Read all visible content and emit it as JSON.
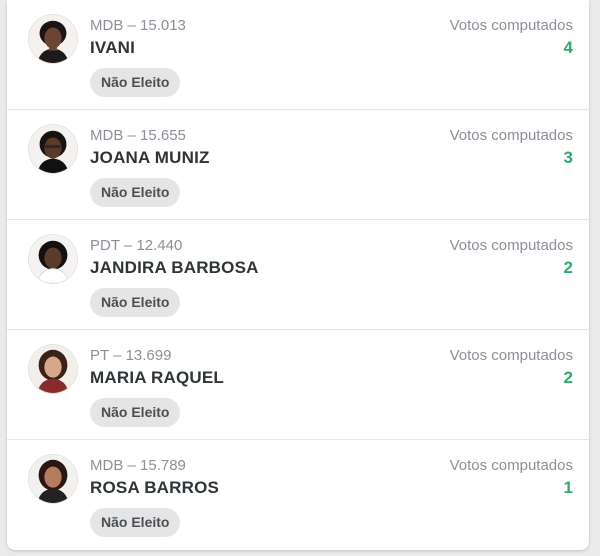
{
  "accent_color": "#2eab6d",
  "candidates": [
    {
      "party_number": "MDB – 15.013",
      "name": "IVANI",
      "status": "Não Eleito",
      "votes_label": "Votos computados",
      "votes": "4",
      "avatar_icon": "candidate-photo"
    },
    {
      "party_number": "MDB – 15.655",
      "name": "JOANA MUNIZ",
      "status": "Não Eleito",
      "votes_label": "Votos computados",
      "votes": "3",
      "avatar_icon": "candidate-photo"
    },
    {
      "party_number": "PDT – 12.440",
      "name": "JANDIRA BARBOSA",
      "status": "Não Eleito",
      "votes_label": "Votos computados",
      "votes": "2",
      "avatar_icon": "candidate-photo"
    },
    {
      "party_number": "PT – 13.699",
      "name": "MARIA RAQUEL",
      "status": "Não Eleito",
      "votes_label": "Votos computados",
      "votes": "2",
      "avatar_icon": "candidate-photo"
    },
    {
      "party_number": "MDB – 15.789",
      "name": "ROSA BARROS",
      "status": "Não Eleito",
      "votes_label": "Votos computados",
      "votes": "1",
      "avatar_icon": "candidate-photo"
    }
  ]
}
